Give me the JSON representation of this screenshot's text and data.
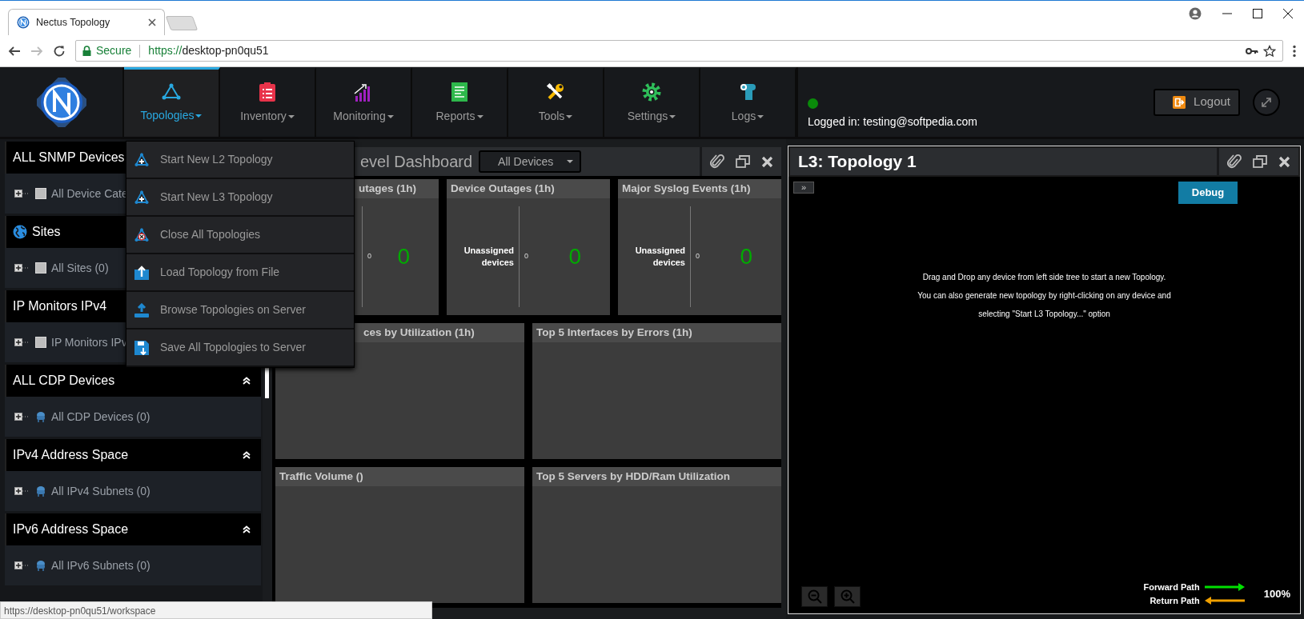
{
  "browser": {
    "tab_title": "Nectus Topology",
    "secure_label": "Secure",
    "url_scheme": "https://",
    "url_host": "desktop-pn0qu51",
    "status_url": "https://desktop-pn0qu51/workspace"
  },
  "nav": {
    "items": [
      {
        "label": "Topologies",
        "kind": "topology",
        "selected": true
      },
      {
        "label": "Inventory",
        "kind": "inventory",
        "selected": false
      },
      {
        "label": "Monitoring",
        "kind": "monitoring",
        "selected": false
      },
      {
        "label": "Reports",
        "kind": "reports",
        "selected": false
      },
      {
        "label": "Tools",
        "kind": "tools",
        "selected": false
      },
      {
        "label": "Settings",
        "kind": "settings",
        "selected": false
      },
      {
        "label": "Logs",
        "kind": "logs",
        "selected": false
      }
    ],
    "online": true,
    "login_text": "Logged in: testing@softpedia.com",
    "logout": "Logout"
  },
  "topologies_menu": [
    {
      "label": "Start New L2 Topology",
      "kind": "new"
    },
    {
      "label": "Start New L3 Topology",
      "kind": "new"
    },
    {
      "label": "Close All Topologies",
      "kind": "close"
    },
    {
      "label": "Load Topology from File",
      "kind": "load"
    },
    {
      "label": "Browse Topologies on Server",
      "kind": "browse"
    },
    {
      "label": "Save All Topologies to Server",
      "kind": "save"
    }
  ],
  "sidebar": [
    {
      "title": "ALL SNMP Devices",
      "kind": "plain",
      "item": {
        "label": "All Device Cate",
        "kind": "square"
      }
    },
    {
      "title": "Sites",
      "kind": "globe",
      "item": {
        "label": "All Sites (0)",
        "kind": "square"
      }
    },
    {
      "title": "IP Monitors IPv4",
      "kind": "plain",
      "item": {
        "label": "IP Monitors IPv",
        "kind": "square"
      }
    },
    {
      "title": "ALL CDP Devices",
      "kind": "plain",
      "item": {
        "label": "All CDP Devices (0)",
        "kind": "device"
      }
    },
    {
      "title": "IPv4 Address Space",
      "kind": "plain",
      "item": {
        "label": "All IPv4 Subnets (0)",
        "kind": "device"
      }
    },
    {
      "title": "IPv6 Address Space",
      "kind": "plain",
      "item": {
        "label": "All IPv6 Subnets (0)",
        "kind": "device"
      }
    }
  ],
  "dashboard": {
    "title": "evel Dashboard",
    "filter": "All Devices",
    "stat_cards": [
      {
        "title": "utages (1h)",
        "small": "0",
        "big": "0"
      },
      {
        "title": "Device Outages (1h)",
        "label": "Unassigned devices",
        "small": "0",
        "big": "0"
      },
      {
        "title": "Major Syslog Events (1h)",
        "label": "Unassigned devices",
        "small": "0",
        "big": "0"
      }
    ],
    "panels": [
      {
        "title": "ces by Utilization (1h)"
      },
      {
        "title": "Top 5 Interfaces by Errors (1h)"
      },
      {
        "title": "Traffic Volume ()"
      },
      {
        "title": "Top 5 Servers by HDD/Ram Utilization"
      }
    ]
  },
  "topology": {
    "title": "L3: Topology 1",
    "toggle": "»",
    "debug": "Debug",
    "help": [
      "Drag and Drop any device from left side tree to start a new Topology.",
      "You can also generate new topology by right-clicking on any device and",
      "selecting  \"Start L3 Topology...\" option"
    ],
    "legend": [
      {
        "label": "Forward Path",
        "color": "#00e000",
        "kind": "forward"
      },
      {
        "label": "Return Path",
        "color": "#f0a000",
        "kind": "return"
      }
    ],
    "zoom": "100%"
  }
}
